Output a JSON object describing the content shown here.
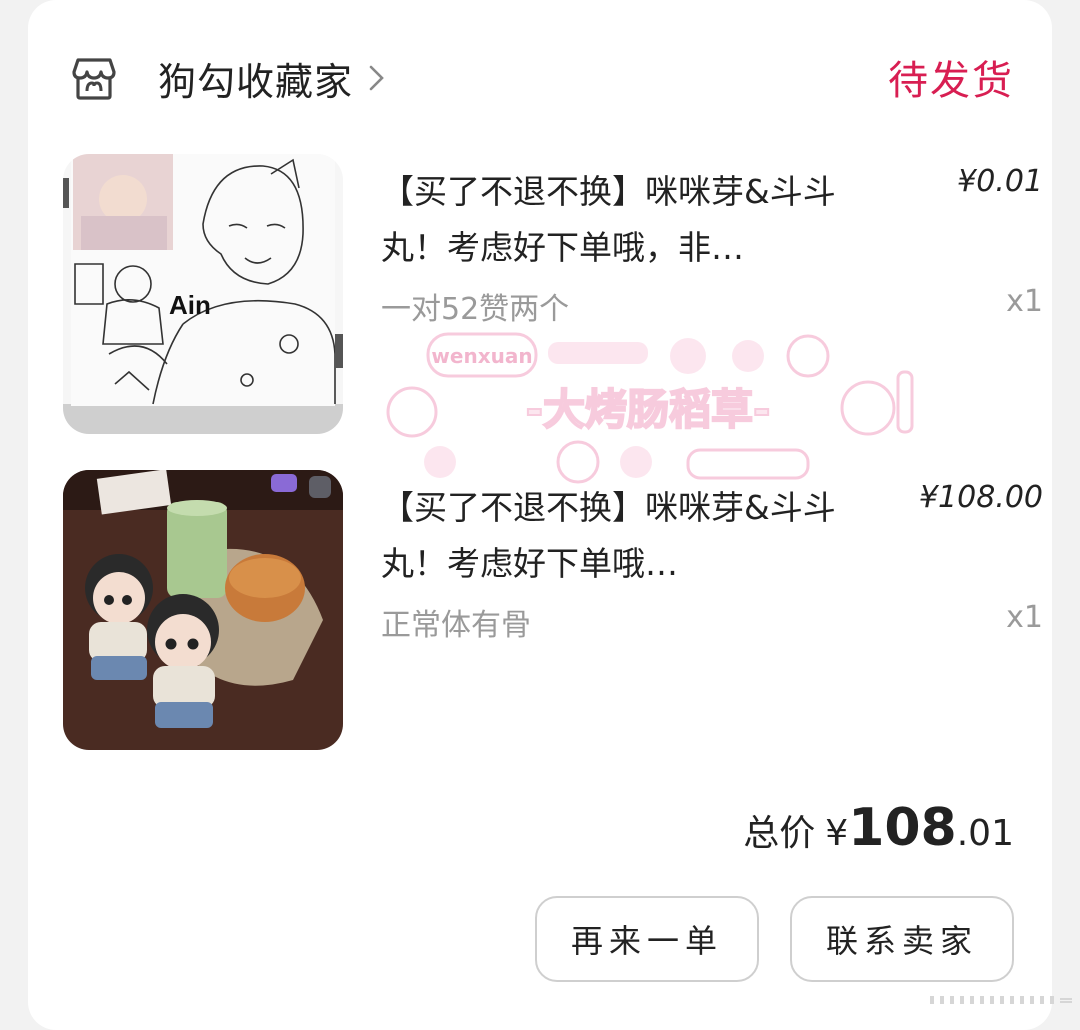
{
  "shop": {
    "name": "狗勾收藏家",
    "icon": "shop-icon",
    "status": "待发货",
    "status_color": "#d81e52"
  },
  "items": [
    {
      "title": "【买了不退不换】咪咪芽&斗斗丸！考虑好下单哦，非…",
      "price": "¥0.01",
      "spec": "一对52赞两个",
      "qty": "x1",
      "thumb_label": "Ain"
    },
    {
      "title": "【买了不退不换】咪咪芽&斗斗丸！考虑好下单哦…",
      "price": "¥108.00",
      "spec": "正常体有骨",
      "qty": "x1"
    }
  ],
  "total": {
    "label": "总价",
    "currency": "¥",
    "integer": "108",
    "decimal": ".01"
  },
  "buttons": {
    "rebuy": "再来一单",
    "contact": "联系卖家"
  },
  "watermark": {
    "tag": "wenxuan",
    "text": "-大烤肠稻草-",
    "color": "#f4a7c6"
  }
}
